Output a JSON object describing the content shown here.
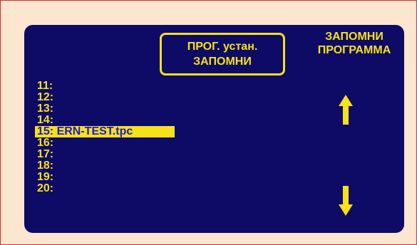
{
  "mode_box": {
    "line1": "ПРОГ. устан.",
    "line2": "ЗАПОМНИ"
  },
  "softkey": {
    "line1": "ЗАПОМНИ",
    "line2": "ПРОГРАММА"
  },
  "programs": [
    {
      "num": "11:",
      "name": ""
    },
    {
      "num": "12:",
      "name": ""
    },
    {
      "num": "13:",
      "name": ""
    },
    {
      "num": "14:",
      "name": ""
    },
    {
      "num": "15:",
      "name": " ERN-TEST.tpc"
    },
    {
      "num": "16:",
      "name": ""
    },
    {
      "num": "17:",
      "name": ""
    },
    {
      "num": "18:",
      "name": ""
    },
    {
      "num": "19:",
      "name": ""
    },
    {
      "num": "20:",
      "name": ""
    }
  ],
  "selected_index": 4,
  "icons": {
    "up": "arrow-up-icon",
    "down": "arrow-down-icon"
  },
  "colors": {
    "page_background": "#fde6d0",
    "page_border": "#d32f2f",
    "screen_background": "#0d0b66",
    "text": "#f7e11a",
    "selected_text": "#1a1ad6"
  }
}
